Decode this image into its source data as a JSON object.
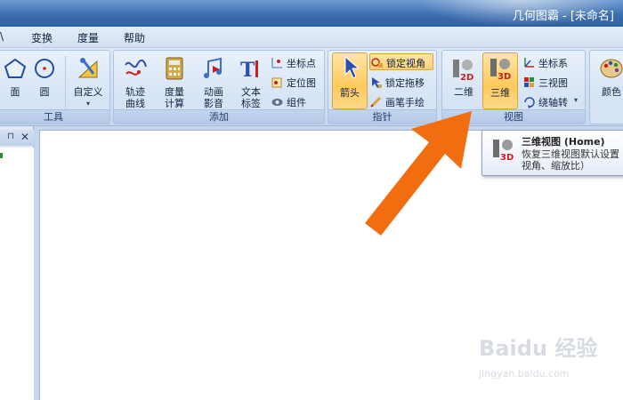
{
  "window": {
    "title": "几何图霸 - [未命名]"
  },
  "menu": {
    "items": [
      "\\",
      "变换",
      "度量",
      "帮助"
    ]
  },
  "ribbon": {
    "groups": {
      "tools": {
        "label": "工具",
        "buttons": [
          {
            "label": "面",
            "icon": "polygon-icon"
          },
          {
            "label": "圆",
            "icon": "circle-icon"
          },
          {
            "label": "自定义",
            "icon": "custom-tool-icon"
          }
        ]
      },
      "add": {
        "label": "添加",
        "buttons": [
          {
            "label": "轨迹曲线",
            "icon": "trace-curve-icon"
          },
          {
            "label": "度量计算",
            "icon": "calculator-icon"
          },
          {
            "label": "动画影音",
            "icon": "animation-icon"
          },
          {
            "label": "文本标签",
            "icon": "text-label-icon"
          }
        ],
        "small": [
          {
            "label": "坐标点",
            "icon": "coordinate-point-icon"
          },
          {
            "label": "定位图",
            "icon": "locate-image-icon"
          },
          {
            "label": "组件",
            "icon": "component-icon"
          }
        ]
      },
      "pointer": {
        "label": "指针",
        "big": {
          "label": "箭头",
          "icon": "arrow-pointer-icon"
        },
        "small": [
          {
            "label": "锁定视角",
            "icon": "lock-view-icon"
          },
          {
            "label": "锁定拖移",
            "icon": "lock-drag-icon"
          },
          {
            "label": "画笔手绘",
            "icon": "pen-draw-icon"
          }
        ]
      },
      "view": {
        "label": "视图",
        "buttons": [
          {
            "label": "二维",
            "icon": "2d-view-icon",
            "badge": "2D"
          },
          {
            "label": "三维",
            "icon": "3d-view-icon",
            "badge": "3D"
          }
        ],
        "small": [
          {
            "label": "坐标系",
            "icon": "axes-icon"
          },
          {
            "label": "三视图",
            "icon": "three-view-icon"
          },
          {
            "label": "绕轴转",
            "icon": "rotate-axis-icon"
          }
        ]
      },
      "color": {
        "label": "颜色",
        "icon": "palette-icon"
      }
    }
  },
  "tooltip": {
    "badge": "3D",
    "title": "三维视图 (Home)",
    "description": "恢复三维视图默认设置视角、缩放比）"
  },
  "watermark": {
    "logo": "Baidu 经验",
    "url": "jingyan.baidu.com"
  },
  "colors": {
    "accent_arrow": "#f26d0f",
    "selected": "#ffc95c"
  }
}
